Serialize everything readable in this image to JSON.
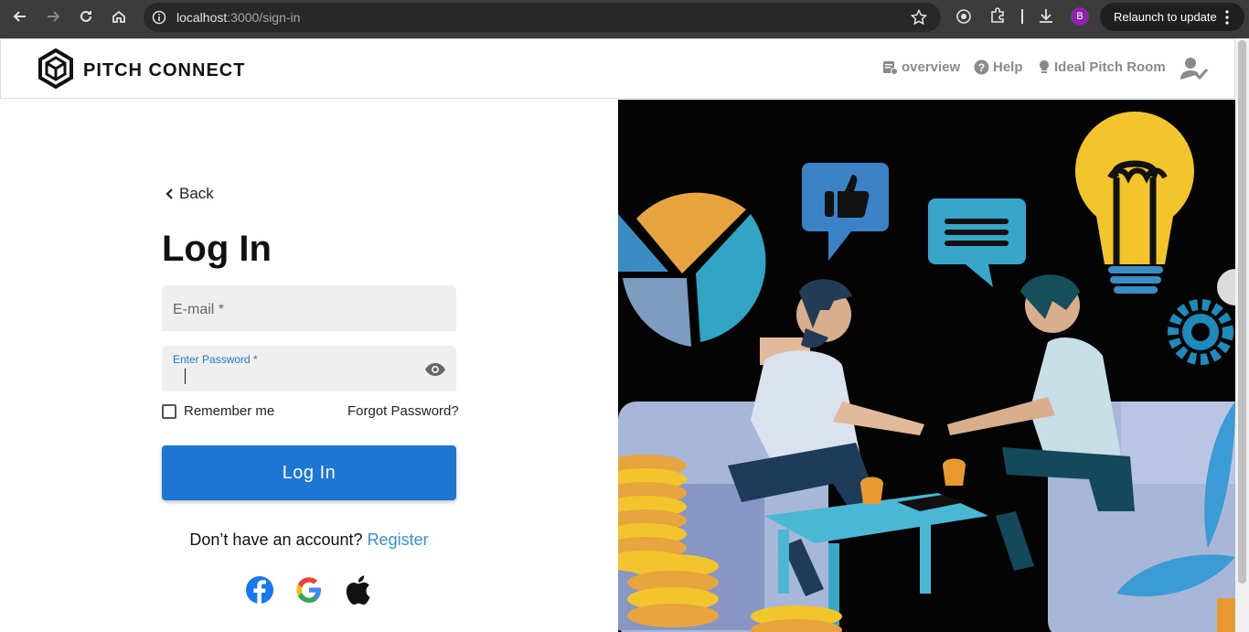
{
  "browser": {
    "url_host": "localhost",
    "url_path": ":3000/sign-in",
    "profile_initial": "B",
    "relaunch_label": "Relaunch to update"
  },
  "header": {
    "brand": "PITCH CONNECT",
    "nav": [
      {
        "label": "overview",
        "icon": "overview-icon"
      },
      {
        "label": "Help",
        "icon": "help-icon"
      },
      {
        "label": "Ideal Pitch Room",
        "icon": "lightbulb-icon"
      }
    ],
    "account_icon": "user-check-icon"
  },
  "form": {
    "back_label": "Back",
    "title": "Log In",
    "email_label": "E-mail *",
    "password_label": "Enter Password *",
    "remember_label": "Remember me",
    "forgot_label": "Forgot Password?",
    "submit_label": "Log In",
    "no_account_text": "Don’t have an account?",
    "register_label": "Register"
  },
  "social": [
    "facebook-icon",
    "google-icon",
    "apple-icon"
  ],
  "colors": {
    "primary": "#1c76d2",
    "link": "#3a8fdc",
    "nav_text": "#8a8a8a"
  }
}
